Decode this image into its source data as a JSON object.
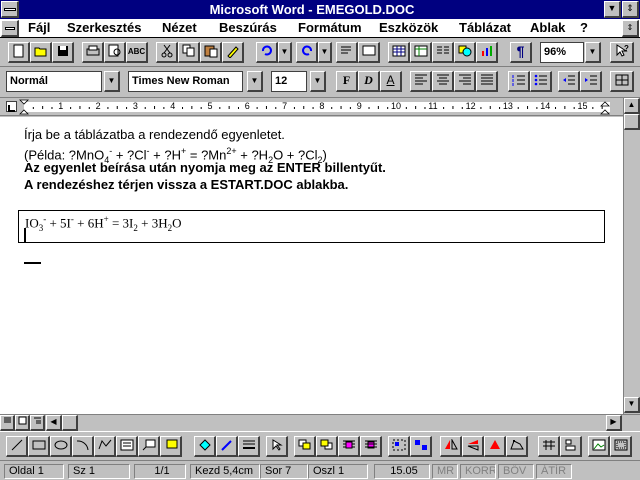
{
  "window": {
    "title": "Microsoft Word - EMEGOLD.DOC",
    "minimize_glyph": "▼",
    "maximize_glyph": "▲",
    "restore_glyph": "⇕"
  },
  "menu": [
    {
      "label": "Fájl"
    },
    {
      "label": "Szerkesztés"
    },
    {
      "label": "Nézet"
    },
    {
      "label": "Beszúrás"
    },
    {
      "label": "Formátum"
    },
    {
      "label": "Eszközök"
    },
    {
      "label": "Táblázat"
    },
    {
      "label": "Ablak"
    },
    {
      "label": "?"
    }
  ],
  "standard_toolbar": {
    "zoom": "96%",
    "paragraph_glyph": "¶"
  },
  "format_toolbar": {
    "style": "Normál",
    "font": "Times New Roman",
    "size": "12",
    "bold": "F",
    "italic": "D",
    "underline": "A"
  },
  "ruler": {
    "numbers": [
      "1",
      "2",
      "3",
      "4",
      "5",
      "6",
      "7",
      "8",
      "9",
      "10",
      "11",
      "12",
      "13",
      "14",
      "15"
    ]
  },
  "document": {
    "line1": "Írja be a táblázatba a rendezendő egyenletet.",
    "line2_prefix": "(Példa: ?MnO",
    "line2_sub1": "4",
    "line2_sup1": "-",
    "line2_a": " + ?Cl",
    "line2_sup2": "-",
    "line2_b": " + ?H",
    "line2_sup3": "+",
    "line2_c": " = ?Mn",
    "line2_sup4": "2+",
    "line2_d": " + ?H",
    "line2_sub2": "2",
    "line2_e": "O + ?Cl",
    "line2_sub3": "2",
    "line2_f": ")",
    "line3": "Az egyenlet beírása után nyomja meg az ENTER billentyűt.",
    "line4": "A rendezéshez térjen vissza a ESTART.DOC ablakba.",
    "equation": {
      "p1": "IO",
      "s1": "3",
      "u1": "-",
      "p2": " + 5I",
      "u2": "-",
      "p3": " + 6H",
      "u3": "+",
      "p4": " = 3I",
      "s2": "2",
      "p5": " + 3H",
      "s3": "2",
      "p6": "O"
    }
  },
  "status": {
    "page": "Oldal 1",
    "section": "Sz 1",
    "pages": "1/1",
    "at": "Kezd 5,4cm",
    "line": "Sor 7",
    "col": "Oszl 1",
    "time": "15.05",
    "mr": "MR",
    "korr": "KORR",
    "bov": "BŐV",
    "atir": "ÁTÍR"
  }
}
